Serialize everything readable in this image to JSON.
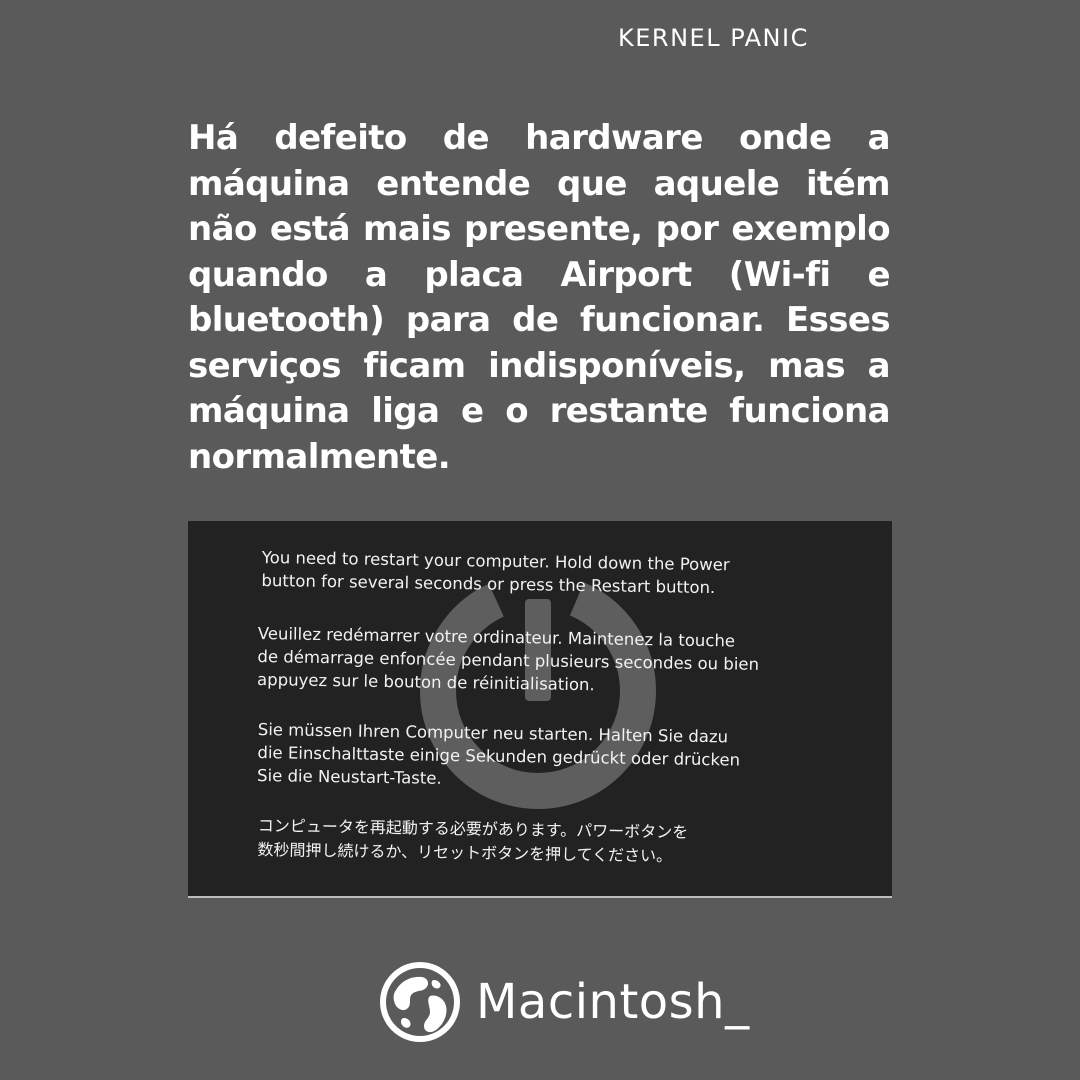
{
  "header": {
    "label": "KERNEL PANIC"
  },
  "body": {
    "paragraph": "Há defeito de hardware onde a máquina entende que aquele itém não está mais presente, por exemplo quando a placa Airport (Wi-fi e bluetooth) para de funcionar. Esses serviços ficam indisponíveis, mas a máquina liga e o restante funciona normalmente."
  },
  "panic_screen": {
    "english": "You need to restart your computer. Hold down the Power\nbutton for several seconds or press the Restart button.",
    "french": "Veuillez redémarrer votre ordinateur. Maintenez la touche\nde démarrage enfoncée pendant plusieurs secondes ou bien\nappuyez sur le bouton de réinitialisation.",
    "german": "Sie müssen Ihren Computer neu starten. Halten Sie dazu\ndie Einschalttaste einige Sekunden gedrückt oder drücken\nSie die Neustart-Taste.",
    "japanese": "コンピュータを再起動する必要があります。パワーボタンを\n数秒間押し続けるか、リセットボタンを押してください。",
    "icon": "power-icon"
  },
  "brand": {
    "name": "Macintosh_",
    "icon": "globe-icon"
  },
  "colors": {
    "background": "#5a5a5a",
    "panic_background": "#222222",
    "text": "#ffffff"
  }
}
